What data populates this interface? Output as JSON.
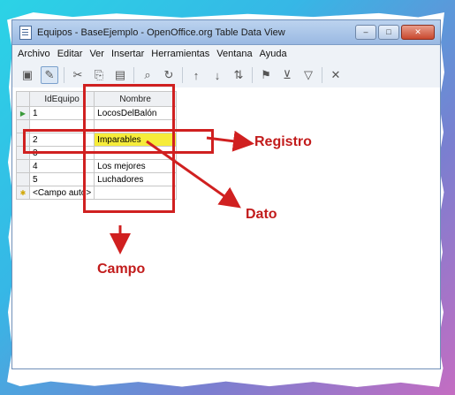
{
  "window": {
    "title": "Equipos - BaseEjemplo - OpenOffice.org Table Data View",
    "buttons": {
      "minimize": "–",
      "maximize": "□",
      "close": "✕"
    }
  },
  "menu": [
    "Archivo",
    "Editar",
    "Ver",
    "Insertar",
    "Herramientas",
    "Ventana",
    "Ayuda"
  ],
  "toolbar": {
    "icons": [
      "save-icon",
      "edit-icon",
      "cut-icon",
      "copy-icon",
      "paste-icon",
      "find-icon",
      "sort-ascending-icon",
      "sort-descending-icon",
      "filter-icon",
      "auto-filter-icon",
      "remove-filter-icon"
    ]
  },
  "table": {
    "headers": {
      "id": "IdEquipo",
      "name": "Nombre"
    },
    "rows": [
      {
        "id": "1",
        "name": "LocosDelBalón",
        "marker": "▶"
      },
      {
        "id": "",
        "name": "",
        "marker": ""
      },
      {
        "id": "2",
        "name": "Imparables",
        "marker": ""
      },
      {
        "id": "3",
        "name": "",
        "marker": ""
      },
      {
        "id": "4",
        "name": "Los mejores",
        "marker": ""
      },
      {
        "id": "5",
        "name": "Luchadores",
        "marker": ""
      }
    ],
    "new_row": {
      "id": "<Campo auto>",
      "marker": "✱"
    }
  },
  "annotations": {
    "registro": "Registro",
    "dato": "Dato",
    "campo": "Campo"
  },
  "colors": {
    "annotation": "#d02020",
    "highlight": "#f6ec3a"
  }
}
